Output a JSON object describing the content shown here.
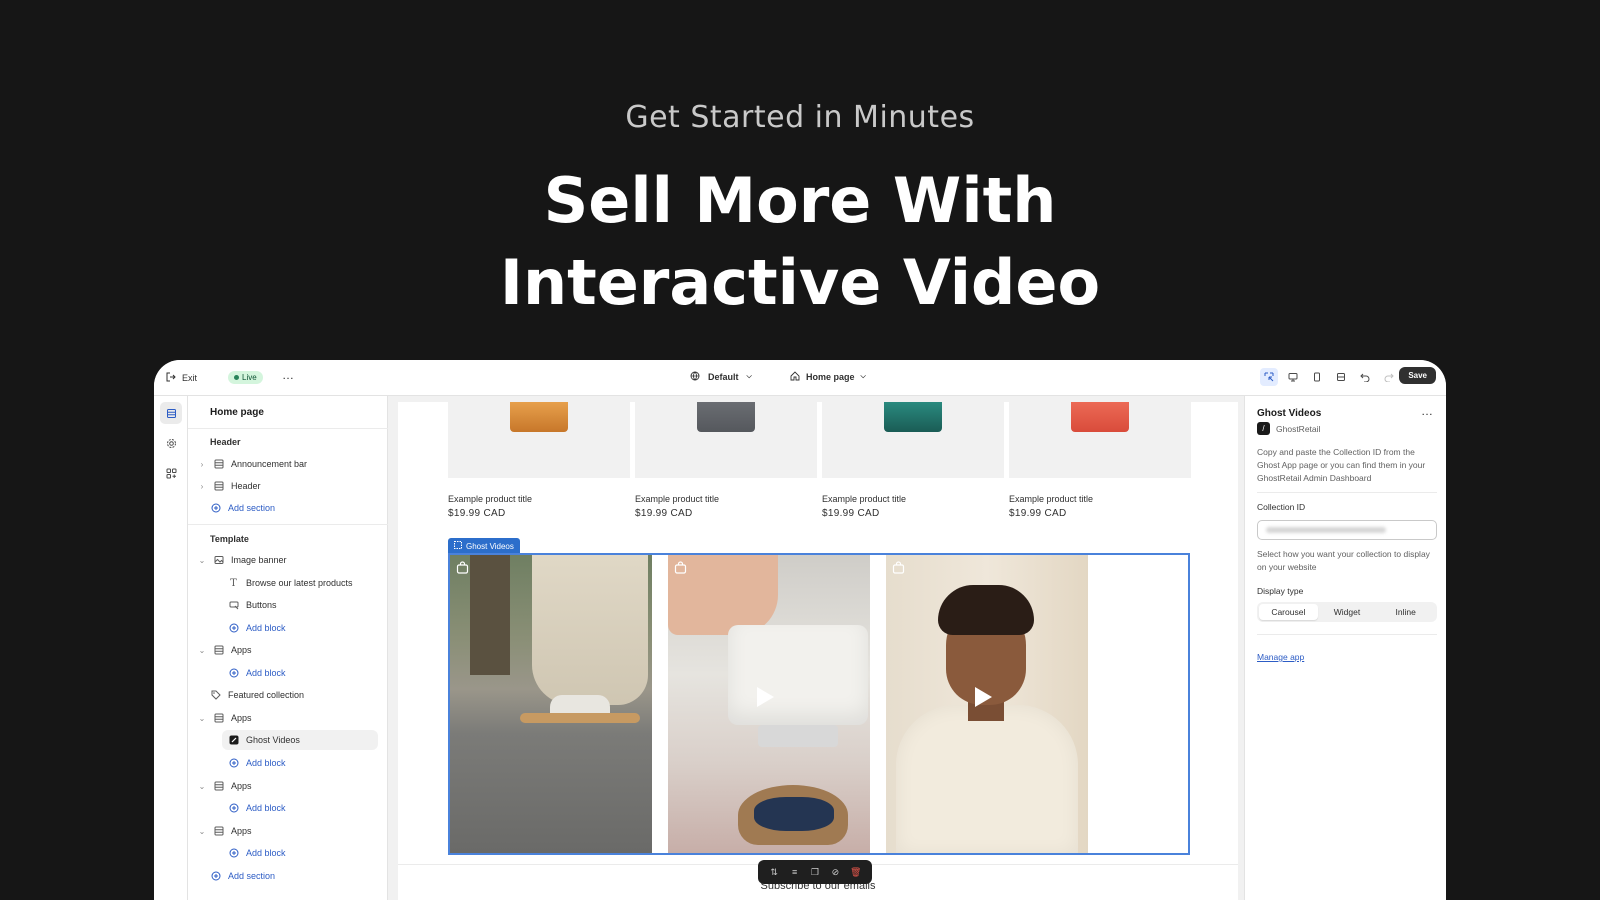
{
  "hero": {
    "kicker": "Get Started in Minutes",
    "title_line1": "Sell More With",
    "title_line2": "Interactive Video"
  },
  "topbar": {
    "exit_label": "Exit",
    "live_badge": "Live",
    "more": "…",
    "theme_label": "Default",
    "page_label": "Home page",
    "save_label": "Save"
  },
  "sidebar": {
    "title": "Home page",
    "header_group": "Header",
    "header_items": [
      {
        "label": "Announcement bar"
      },
      {
        "label": "Header"
      }
    ],
    "add_section": "Add section",
    "template_group": "Template",
    "image_banner": "Image banner",
    "banner_blocks": [
      {
        "label": "Browse our latest products"
      },
      {
        "label": "Buttons"
      }
    ],
    "add_block": "Add block",
    "apps": "Apps",
    "featured_collection": "Featured collection",
    "ghost_videos": "Ghost Videos"
  },
  "canvas": {
    "products": [
      {
        "title": "Example product title",
        "price": "$19.99 CAD",
        "swatch": "#d98a3a"
      },
      {
        "title": "Example product title",
        "price": "$19.99 CAD",
        "swatch": "#5b5e63"
      },
      {
        "title": "Example product title",
        "price": "$19.99 CAD",
        "swatch": "#1e6a63"
      },
      {
        "title": "Example product title",
        "price": "$19.99 CAD",
        "swatch": "#e05a48"
      }
    ],
    "section_tag": "Ghost Videos",
    "subscribe": "Subscribe to our emails"
  },
  "panel": {
    "title": "Ghost Videos",
    "more": "…",
    "app_name": "GhostRetail",
    "description": "Copy and paste the Collection ID from the Ghost App page or you can find them in your GhostRetail Admin Dashboard",
    "collection_label": "Collection ID",
    "display_hint": "Select how you want your collection to display on your website",
    "display_label": "Display type",
    "display_options": [
      "Carousel",
      "Widget",
      "Inline"
    ],
    "display_selected": "Carousel",
    "manage_link": "Manage app"
  },
  "colors": {
    "accent": "#2c5cc5",
    "section_highlight": "#2c6ecb",
    "live_bg": "#d4f5dd",
    "background": "#161616"
  }
}
